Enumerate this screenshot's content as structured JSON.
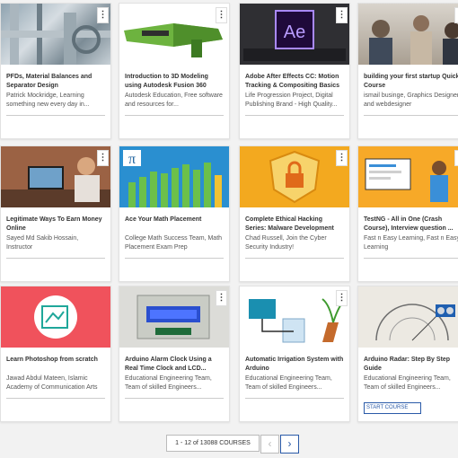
{
  "courses": [
    {
      "title": "PFDs, Material Balances and Separator Design",
      "author": "Patrick Mockridge, Learning something new every day in..."
    },
    {
      "title": "Introduction to 3D Modeling using Autodesk Fusion 360",
      "author": "Autodesk Education, Free software and resources for..."
    },
    {
      "title": "Adobe After Effects CC: Motion Tracking & Compositing Basics",
      "author": "Life Progression Project, Digital Publishing Brand - High Quality..."
    },
    {
      "title": "building your first startup Quick Course",
      "author": "ismail businge, Graphics Designer and webdesigner"
    },
    {
      "title": "Legitimate Ways To Earn Money Online",
      "author": "Sayed Md Sakib Hossain, Instructor"
    },
    {
      "title": "Ace Your Math Placement",
      "author": "College Math Success Team, Math Placement Exam Prep"
    },
    {
      "title": "Complete Ethical Hacking Series: Malware Development",
      "author": "Chad Russell, Join the Cyber Security Industry!"
    },
    {
      "title": "TestNG - All in One (Crash Course), Interview question ...",
      "author": "Fast n Easy Learning, Fast n Easy Learning"
    },
    {
      "title": "Learn Photoshop from scratch",
      "author": "Jawad Abdul Mateen, Islamic Academy of Communication Arts"
    },
    {
      "title": "Arduino Alarm Clock Using a Real Time Clock and LCD...",
      "author": "Educational Engineering Team, Team of skilled Engineers..."
    },
    {
      "title": "Automatic Irrigation System with Arduino",
      "author": "Educational Engineering Team, Team of skilled Engineers..."
    },
    {
      "title": "Arduino Radar: Step By Step Guide",
      "author": "Educational Engineering Team, Team of skilled Engineers..."
    }
  ],
  "menu_glyph": "⋮",
  "ae_logo": "Ae",
  "pi_symbol": "π",
  "start_course_label": "START COURSE",
  "pagination": {
    "label": "1 - 12 of 13088 COURSES",
    "prev": "‹",
    "next": "›"
  }
}
